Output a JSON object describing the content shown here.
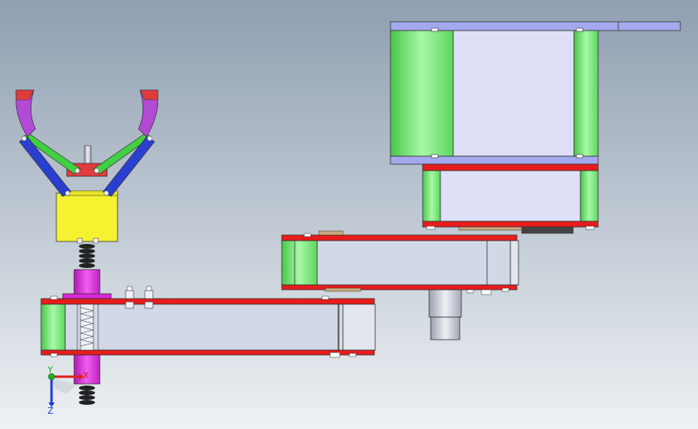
{
  "viewport": {
    "background_top": "#8f9fb1",
    "background_bottom": "#eef1f4"
  },
  "triad": {
    "x_label": "X",
    "y_label": "Y",
    "z_label": "Z",
    "x_color": "#e02020",
    "y_color": "#20b020",
    "z_color": "#2040d0"
  },
  "colors": {
    "blue_plate": "#a4a8ec",
    "green_housing": "#7fe67f",
    "light_face": "#dde0f6",
    "red_band": "#e81c1c",
    "gray_arm": "#d3d8e6",
    "yellow_block": "#f6f230",
    "magenta": "#d828d8",
    "gripper_red": "#e03c3c",
    "gripper_blue": "#2a3fd0",
    "gripper_green": "#41d041",
    "gripper_purple": "#b24ad6",
    "steel": "#c4c8d4"
  }
}
